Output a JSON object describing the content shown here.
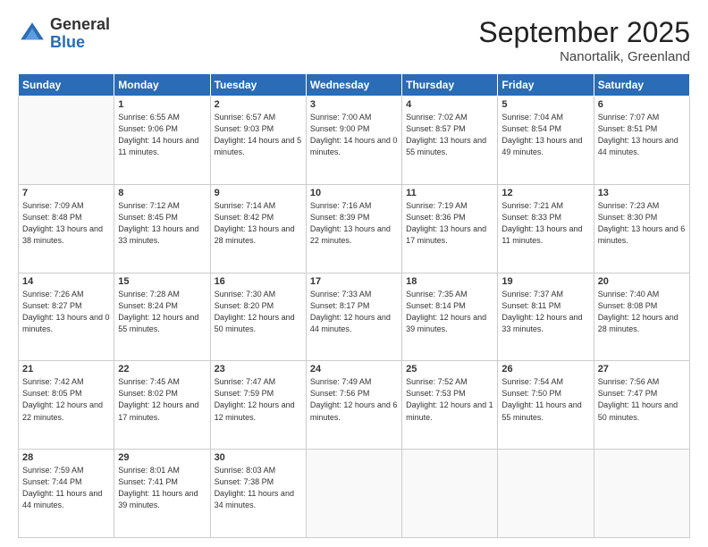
{
  "logo": {
    "general": "General",
    "blue": "Blue"
  },
  "header": {
    "month": "September 2025",
    "location": "Nanortalik, Greenland"
  },
  "weekdays": [
    "Sunday",
    "Monday",
    "Tuesday",
    "Wednesday",
    "Thursday",
    "Friday",
    "Saturday"
  ],
  "weeks": [
    [
      {
        "day": "",
        "sunrise": "",
        "sunset": "",
        "daylight": ""
      },
      {
        "day": "1",
        "sunrise": "Sunrise: 6:55 AM",
        "sunset": "Sunset: 9:06 PM",
        "daylight": "Daylight: 14 hours and 11 minutes."
      },
      {
        "day": "2",
        "sunrise": "Sunrise: 6:57 AM",
        "sunset": "Sunset: 9:03 PM",
        "daylight": "Daylight: 14 hours and 5 minutes."
      },
      {
        "day": "3",
        "sunrise": "Sunrise: 7:00 AM",
        "sunset": "Sunset: 9:00 PM",
        "daylight": "Daylight: 14 hours and 0 minutes."
      },
      {
        "day": "4",
        "sunrise": "Sunrise: 7:02 AM",
        "sunset": "Sunset: 8:57 PM",
        "daylight": "Daylight: 13 hours and 55 minutes."
      },
      {
        "day": "5",
        "sunrise": "Sunrise: 7:04 AM",
        "sunset": "Sunset: 8:54 PM",
        "daylight": "Daylight: 13 hours and 49 minutes."
      },
      {
        "day": "6",
        "sunrise": "Sunrise: 7:07 AM",
        "sunset": "Sunset: 8:51 PM",
        "daylight": "Daylight: 13 hours and 44 minutes."
      }
    ],
    [
      {
        "day": "7",
        "sunrise": "Sunrise: 7:09 AM",
        "sunset": "Sunset: 8:48 PM",
        "daylight": "Daylight: 13 hours and 38 minutes."
      },
      {
        "day": "8",
        "sunrise": "Sunrise: 7:12 AM",
        "sunset": "Sunset: 8:45 PM",
        "daylight": "Daylight: 13 hours and 33 minutes."
      },
      {
        "day": "9",
        "sunrise": "Sunrise: 7:14 AM",
        "sunset": "Sunset: 8:42 PM",
        "daylight": "Daylight: 13 hours and 28 minutes."
      },
      {
        "day": "10",
        "sunrise": "Sunrise: 7:16 AM",
        "sunset": "Sunset: 8:39 PM",
        "daylight": "Daylight: 13 hours and 22 minutes."
      },
      {
        "day": "11",
        "sunrise": "Sunrise: 7:19 AM",
        "sunset": "Sunset: 8:36 PM",
        "daylight": "Daylight: 13 hours and 17 minutes."
      },
      {
        "day": "12",
        "sunrise": "Sunrise: 7:21 AM",
        "sunset": "Sunset: 8:33 PM",
        "daylight": "Daylight: 13 hours and 11 minutes."
      },
      {
        "day": "13",
        "sunrise": "Sunrise: 7:23 AM",
        "sunset": "Sunset: 8:30 PM",
        "daylight": "Daylight: 13 hours and 6 minutes."
      }
    ],
    [
      {
        "day": "14",
        "sunrise": "Sunrise: 7:26 AM",
        "sunset": "Sunset: 8:27 PM",
        "daylight": "Daylight: 13 hours and 0 minutes."
      },
      {
        "day": "15",
        "sunrise": "Sunrise: 7:28 AM",
        "sunset": "Sunset: 8:24 PM",
        "daylight": "Daylight: 12 hours and 55 minutes."
      },
      {
        "day": "16",
        "sunrise": "Sunrise: 7:30 AM",
        "sunset": "Sunset: 8:20 PM",
        "daylight": "Daylight: 12 hours and 50 minutes."
      },
      {
        "day": "17",
        "sunrise": "Sunrise: 7:33 AM",
        "sunset": "Sunset: 8:17 PM",
        "daylight": "Daylight: 12 hours and 44 minutes."
      },
      {
        "day": "18",
        "sunrise": "Sunrise: 7:35 AM",
        "sunset": "Sunset: 8:14 PM",
        "daylight": "Daylight: 12 hours and 39 minutes."
      },
      {
        "day": "19",
        "sunrise": "Sunrise: 7:37 AM",
        "sunset": "Sunset: 8:11 PM",
        "daylight": "Daylight: 12 hours and 33 minutes."
      },
      {
        "day": "20",
        "sunrise": "Sunrise: 7:40 AM",
        "sunset": "Sunset: 8:08 PM",
        "daylight": "Daylight: 12 hours and 28 minutes."
      }
    ],
    [
      {
        "day": "21",
        "sunrise": "Sunrise: 7:42 AM",
        "sunset": "Sunset: 8:05 PM",
        "daylight": "Daylight: 12 hours and 22 minutes."
      },
      {
        "day": "22",
        "sunrise": "Sunrise: 7:45 AM",
        "sunset": "Sunset: 8:02 PM",
        "daylight": "Daylight: 12 hours and 17 minutes."
      },
      {
        "day": "23",
        "sunrise": "Sunrise: 7:47 AM",
        "sunset": "Sunset: 7:59 PM",
        "daylight": "Daylight: 12 hours and 12 minutes."
      },
      {
        "day": "24",
        "sunrise": "Sunrise: 7:49 AM",
        "sunset": "Sunset: 7:56 PM",
        "daylight": "Daylight: 12 hours and 6 minutes."
      },
      {
        "day": "25",
        "sunrise": "Sunrise: 7:52 AM",
        "sunset": "Sunset: 7:53 PM",
        "daylight": "Daylight: 12 hours and 1 minute."
      },
      {
        "day": "26",
        "sunrise": "Sunrise: 7:54 AM",
        "sunset": "Sunset: 7:50 PM",
        "daylight": "Daylight: 11 hours and 55 minutes."
      },
      {
        "day": "27",
        "sunrise": "Sunrise: 7:56 AM",
        "sunset": "Sunset: 7:47 PM",
        "daylight": "Daylight: 11 hours and 50 minutes."
      }
    ],
    [
      {
        "day": "28",
        "sunrise": "Sunrise: 7:59 AM",
        "sunset": "Sunset: 7:44 PM",
        "daylight": "Daylight: 11 hours and 44 minutes."
      },
      {
        "day": "29",
        "sunrise": "Sunrise: 8:01 AM",
        "sunset": "Sunset: 7:41 PM",
        "daylight": "Daylight: 11 hours and 39 minutes."
      },
      {
        "day": "30",
        "sunrise": "Sunrise: 8:03 AM",
        "sunset": "Sunset: 7:38 PM",
        "daylight": "Daylight: 11 hours and 34 minutes."
      },
      {
        "day": "",
        "sunrise": "",
        "sunset": "",
        "daylight": ""
      },
      {
        "day": "",
        "sunrise": "",
        "sunset": "",
        "daylight": ""
      },
      {
        "day": "",
        "sunrise": "",
        "sunset": "",
        "daylight": ""
      },
      {
        "day": "",
        "sunrise": "",
        "sunset": "",
        "daylight": ""
      }
    ]
  ]
}
